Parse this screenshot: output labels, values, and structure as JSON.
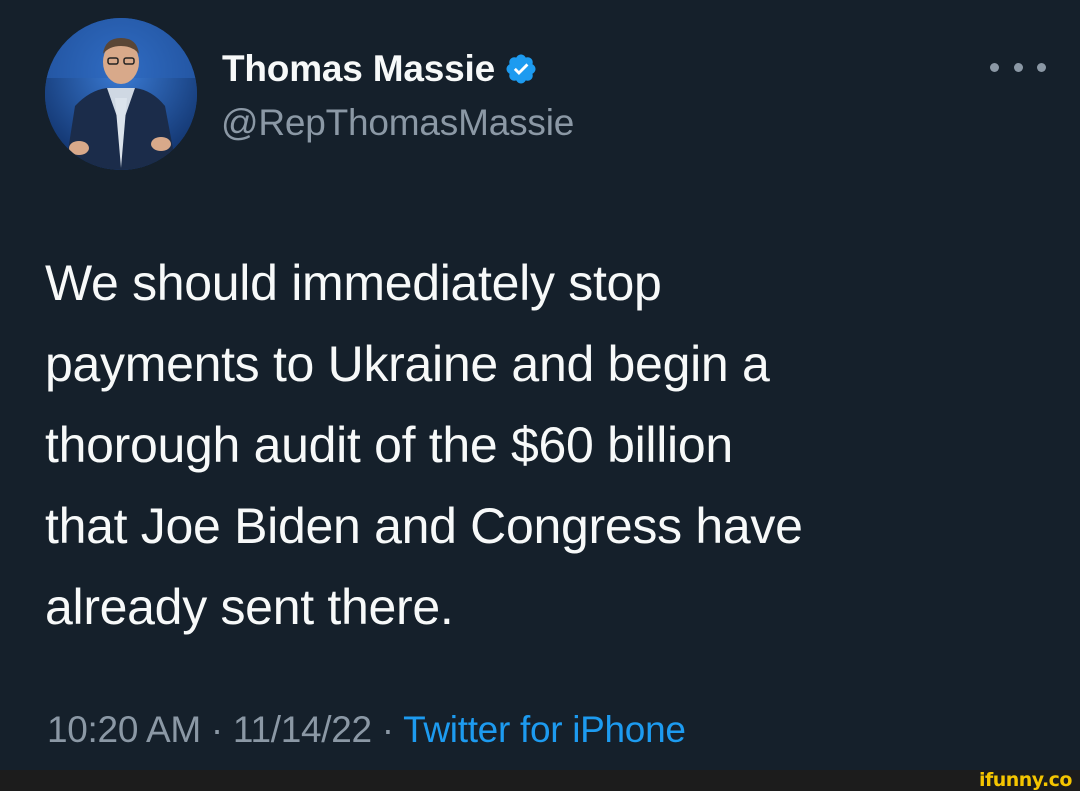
{
  "tweet": {
    "author": {
      "display_name": "Thomas Massie",
      "handle": "@RepThomasMassie",
      "verified": true,
      "verified_color": "#1d9bf0"
    },
    "text": "We should immediately stop\npayments to Ukraine and begin a\nthorough audit of the $60 billion\nthat Joe Biden and Congress have\nalready sent there.",
    "time": "10:20 AM",
    "separator": " · ",
    "date": "11/14/22",
    "source": "Twitter for iPhone"
  },
  "icons": {
    "verified": "verified-badge-icon",
    "more": "more-options-icon"
  },
  "watermark": "ifunny.co",
  "colors": {
    "background": "#15202b",
    "primary_text": "#f7f9f9",
    "secondary_text": "#8b98a5",
    "accent": "#1d9bf0",
    "watermark": "#f5c500"
  }
}
